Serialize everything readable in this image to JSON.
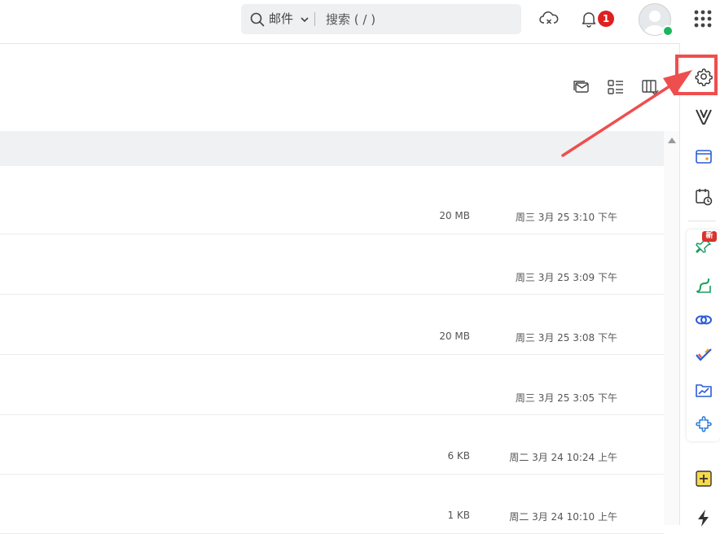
{
  "search": {
    "scope_label": "邮件",
    "placeholder": "搜索 ( / )",
    "icons": [
      "search-icon",
      "chevron-down-icon"
    ]
  },
  "header": {
    "notification_count": "1",
    "icons": [
      "cloud-sync-icon",
      "bell-icon",
      "avatar",
      "apps-grid-icon"
    ],
    "status_color": "#1ab55c",
    "badge_color": "#e02020"
  },
  "toolbar": {
    "icons": [
      "mail-view-icon",
      "list-view-icon",
      "columns-view-icon"
    ]
  },
  "rows": [
    {
      "size": "20 MB",
      "date": "周三 3月 25 3:10 下午"
    },
    {
      "size": "",
      "date": "周三 3月 25 3:09 下午"
    },
    {
      "size": "20 MB",
      "date": "周三 3月 25 3:08 下午"
    },
    {
      "size": "",
      "date": "周三 3月 25 3:05 下午"
    },
    {
      "size": "6 KB",
      "date": "周二 3月 24 10:24 上午"
    },
    {
      "size": "1 KB",
      "date": "周二 3月 24 10:10 上午"
    }
  ],
  "right_rail": {
    "new_badge": "新",
    "icons": [
      "settings-gear-icon",
      "v-logo-icon",
      "wallet-icon",
      "calendar-clock-icon",
      "pin-icon",
      "route-icon",
      "link-icon",
      "check-icon",
      "folder-chart-icon",
      "puzzle-icon",
      "add-note-icon",
      "lightning-icon"
    ]
  },
  "annotation": {
    "color": "#ef4e4e",
    "target": "settings-gear-icon"
  }
}
